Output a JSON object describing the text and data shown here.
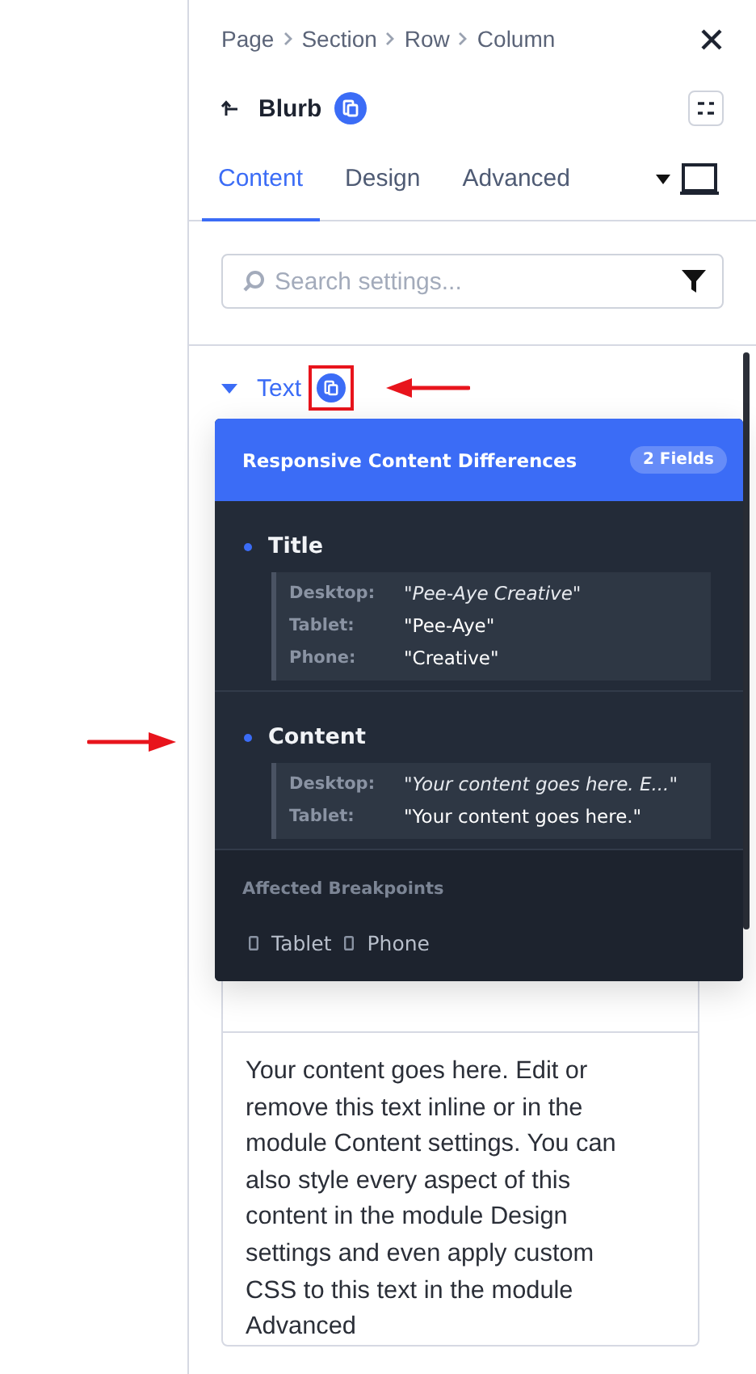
{
  "breadcrumb": [
    "Page",
    "Section",
    "Row",
    "Column"
  ],
  "module": {
    "title": "Blurb"
  },
  "tabs": [
    {
      "label": "Content",
      "selected": true
    },
    {
      "label": "Design",
      "selected": false
    },
    {
      "label": "Advanced",
      "selected": false
    }
  ],
  "search": {
    "placeholder": "Search settings..."
  },
  "group": {
    "label": "Text",
    "expanded": true
  },
  "tooltip": {
    "title": "Responsive Content Differences",
    "badge": "2 Fields",
    "fields": [
      {
        "name": "Title",
        "values": [
          {
            "label": "Desktop:",
            "value": "\"Pee-Aye Creative\"",
            "kind": "desktop"
          },
          {
            "label": "Tablet:",
            "value": "\"Pee-Aye\"",
            "kind": "override"
          },
          {
            "label": "Phone:",
            "value": "\"Creative\"",
            "kind": "override"
          }
        ]
      },
      {
        "name": "Content",
        "values": [
          {
            "label": "Desktop:",
            "value": "\"Your content goes here. E...\"",
            "kind": "desktop"
          },
          {
            "label": "Tablet:",
            "value": "\"Your content goes here.\"",
            "kind": "override"
          }
        ]
      }
    ],
    "footer_title": "Affected Breakpoints",
    "breakpoints": [
      "Tablet",
      "Phone"
    ]
  },
  "editor": {
    "text": "Your content goes here. Edit or remove this text inline or in the module Content settings. You can also style every aspect of this content in the module Design settings and even apply custom CSS to this text in the module Advanced"
  }
}
